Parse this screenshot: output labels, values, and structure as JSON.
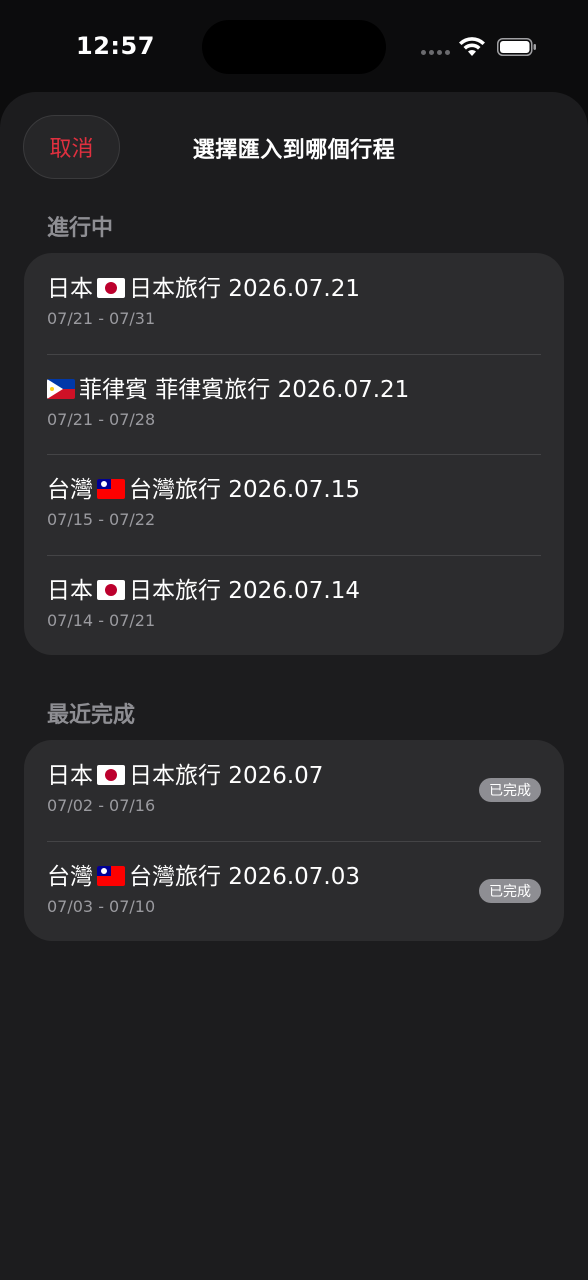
{
  "status_bar": {
    "time": "12:57"
  },
  "header": {
    "cancel_label": "取消",
    "title": "選擇匯入到哪個行程"
  },
  "sections": [
    {
      "title": "進行中",
      "items": [
        {
          "prefix": "日本",
          "flag": "jp",
          "name": "日本旅行 2026.07.21",
          "dates": "07/21 - 07/31"
        },
        {
          "prefix": "",
          "flag": "ph",
          "name": "菲律賓 菲律賓旅行 2026.07.21",
          "dates": "07/21 - 07/28"
        },
        {
          "prefix": "台灣",
          "flag": "tw",
          "name": "台灣旅行 2026.07.15",
          "dates": "07/15 - 07/22"
        },
        {
          "prefix": "日本",
          "flag": "jp",
          "name": "日本旅行 2026.07.14",
          "dates": "07/14 - 07/21"
        }
      ]
    },
    {
      "title": "最近完成",
      "items": [
        {
          "prefix": "日本",
          "flag": "jp",
          "name": "日本旅行 2026.07",
          "dates": "07/02 - 07/16",
          "badge": "已完成"
        },
        {
          "prefix": "台灣",
          "flag": "tw",
          "name": "台灣旅行 2026.07.03",
          "dates": "07/03 - 07/10",
          "badge": "已完成"
        }
      ]
    }
  ],
  "colors": {
    "accent": "#e0303f",
    "sheet": "#1c1c1e",
    "card": "#2c2c2e",
    "badge": "#8e8e93"
  }
}
